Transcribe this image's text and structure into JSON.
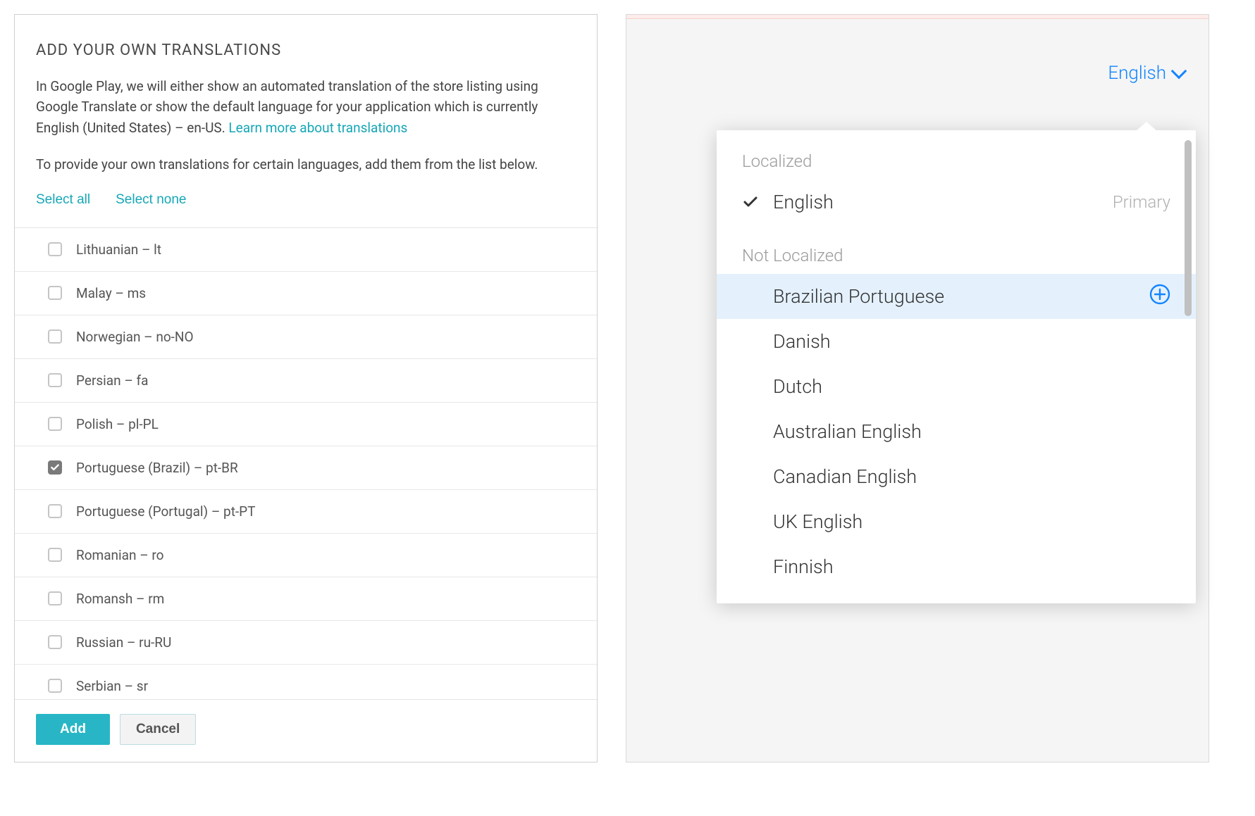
{
  "gp": {
    "title": "ADD YOUR OWN TRANSLATIONS",
    "desc_part1": "In Google Play, we will either show an automated translation of the store listing using Google Translate or show the default language for your application which is currently English (United States) – en-US. ",
    "learn_more": "Learn more about translations",
    "desc2": "To provide your own translations for certain languages, add them from the list below.",
    "select_all": "Select all",
    "select_none": "Select none",
    "languages": [
      {
        "label": "Lithuanian – lt",
        "checked": false
      },
      {
        "label": "Malay – ms",
        "checked": false
      },
      {
        "label": "Norwegian – no-NO",
        "checked": false
      },
      {
        "label": "Persian – fa",
        "checked": false
      },
      {
        "label": "Polish – pl-PL",
        "checked": false
      },
      {
        "label": "Portuguese (Brazil) – pt-BR",
        "checked": true
      },
      {
        "label": "Portuguese (Portugal) – pt-PT",
        "checked": false
      },
      {
        "label": "Romanian – ro",
        "checked": false
      },
      {
        "label": "Romansh – rm",
        "checked": false
      },
      {
        "label": "Russian – ru-RU",
        "checked": false
      },
      {
        "label": "Serbian – sr",
        "checked": false
      }
    ],
    "add_btn": "Add",
    "cancel_btn": "Cancel"
  },
  "ap": {
    "current": "English",
    "localized_label": "Localized",
    "not_localized_label": "Not Localized",
    "primary_label": "Primary",
    "localized": [
      {
        "label": "English",
        "primary": true
      }
    ],
    "not_localized": [
      {
        "label": "Brazilian Portuguese",
        "hovered": true
      },
      {
        "label": "Danish",
        "hovered": false
      },
      {
        "label": "Dutch",
        "hovered": false
      },
      {
        "label": "Australian English",
        "hovered": false
      },
      {
        "label": "Canadian English",
        "hovered": false
      },
      {
        "label": "UK English",
        "hovered": false
      },
      {
        "label": "Finnish",
        "hovered": false
      }
    ]
  }
}
